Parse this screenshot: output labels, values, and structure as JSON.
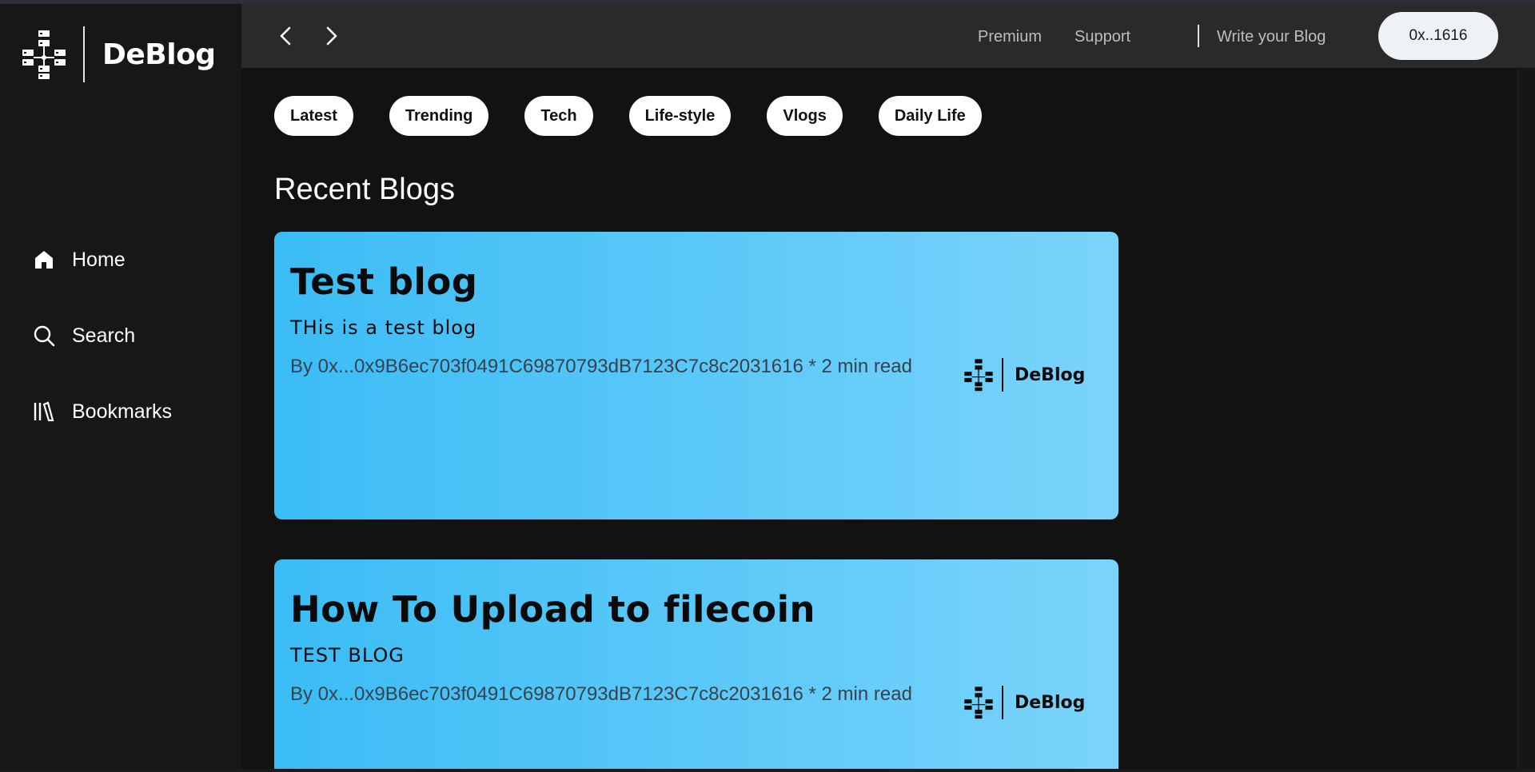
{
  "app": {
    "name": "DeBlog"
  },
  "sidebar": {
    "items": [
      {
        "label": "Home",
        "icon": "home-icon"
      },
      {
        "label": "Search",
        "icon": "search-icon"
      },
      {
        "label": "Bookmarks",
        "icon": "bookmarks-icon"
      }
    ]
  },
  "topbar": {
    "back_icon": "chevron-left-icon",
    "forward_icon": "chevron-right-icon",
    "premium": "Premium",
    "support": "Support",
    "write": "Write your Blog",
    "account": "0x..1616"
  },
  "categories": [
    "Latest",
    "Trending",
    "Tech",
    "Life-style",
    "Vlogs",
    "Daily Life"
  ],
  "section_title": "Recent Blogs",
  "posts": [
    {
      "title": "Test blog",
      "subtitle": "THis is a test blog",
      "meta": "By 0x...0x9B6ec703f0491C69870793dB7123C7c8c2031616 * 2 min read",
      "brand": "DeBlog"
    },
    {
      "title": "How To Upload to filecoin",
      "subtitle": "TEST BLOG",
      "meta": "By 0x...0x9B6ec703f0491C69870793dB7123C7c8c2031616 * 2 min read",
      "brand": "DeBlog"
    }
  ],
  "colors": {
    "sidebar_bg": "#171717",
    "main_bg": "#121212",
    "topbar_bg": "#2a2a2a",
    "card_gradient_start": "#3bbcf5",
    "card_gradient_end": "#7bd4fb"
  }
}
